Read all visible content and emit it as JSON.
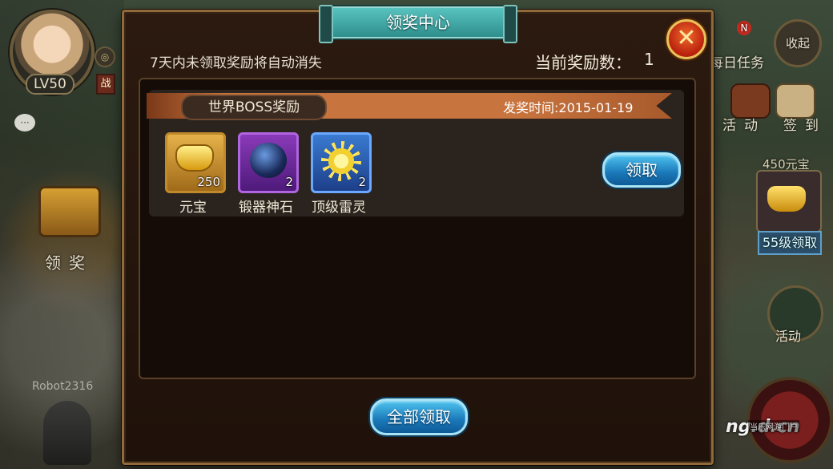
{
  "hud": {
    "level": "LV50",
    "war_badge": "战",
    "chat_icon": "chat-bubble-icon",
    "claim_label": "领奖",
    "player_name": "Robot2316",
    "collapse_label": "收起",
    "daily_task_label": "每日任务",
    "notification_badge": "N",
    "event_label": "活动",
    "signin_label": "签到",
    "yuanbao_reward_label": "450元宝",
    "level55_claim_label": "55级领取",
    "activity_label": "活动",
    "watermark": "ng.d.cn",
    "watermark_sub": "当乐网游门户"
  },
  "dialog": {
    "title": "领奖中心",
    "close_icon": "close-x-icon",
    "notice": "7天内未领取奖励将自动消失",
    "count_label": "当前奖励数：",
    "count_value": "1",
    "claim_all_label": "全部领取",
    "rewards": [
      {
        "title": "世界BOSS奖励",
        "time": "发奖时间:2015-01-19",
        "claim_label": "领取",
        "items": [
          {
            "name": "元宝",
            "qty": "250",
            "icon": "gold-ingot-icon"
          },
          {
            "name": "锻器神石",
            "qty": "2",
            "icon": "forge-stone-icon"
          },
          {
            "name": "顶级雷灵",
            "qty": "2",
            "icon": "thunder-spirit-icon"
          }
        ]
      }
    ]
  },
  "colors": {
    "dialog_bg": "#24150c",
    "dialog_border": "#8f6a3a",
    "title_plate": "#2f8f8d",
    "button_blue": "#1a78b8",
    "banner": "#c8743e",
    "close_red": "#b8200e"
  }
}
